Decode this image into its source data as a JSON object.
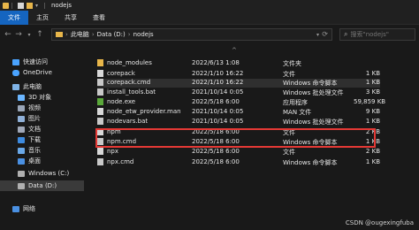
{
  "window": {
    "title": "nodejs"
  },
  "ribbon": {
    "tabs": [
      "文件",
      "主页",
      "共享",
      "查看"
    ]
  },
  "address": {
    "crumbs": [
      "此电脑",
      "Data (D:)",
      "nodejs"
    ]
  },
  "search": {
    "placeholder": "搜索\"nodejs\""
  },
  "sidebar": {
    "items": [
      {
        "label": "快速访问",
        "icon": "star-icon",
        "color": "#4aa3ff"
      },
      {
        "label": "OneDrive",
        "icon": "cloud-icon",
        "color": "#4aa3ff"
      },
      {
        "label": "此电脑",
        "icon": "computer-icon",
        "color": "#7fb3e6"
      },
      {
        "label": "3D 对象",
        "icon": "cube-icon",
        "color": "#6bb6ff"
      },
      {
        "label": "视频",
        "icon": "video-icon",
        "color": "#9aa6b8"
      },
      {
        "label": "图片",
        "icon": "picture-icon",
        "color": "#8fb0d8"
      },
      {
        "label": "文档",
        "icon": "document-icon",
        "color": "#a0a8b8"
      },
      {
        "label": "下载",
        "icon": "download-icon",
        "color": "#3d8be0"
      },
      {
        "label": "音乐",
        "icon": "music-icon",
        "color": "#6aa8e8"
      },
      {
        "label": "桌面",
        "icon": "desktop-icon",
        "color": "#4a90e2"
      },
      {
        "label": "Windows (C:)",
        "icon": "drive-icon",
        "color": "#b0b0b0"
      },
      {
        "label": "Data (D:)",
        "icon": "drive-icon",
        "color": "#b0b0b0"
      },
      {
        "label": "网络",
        "icon": "network-icon",
        "color": "#4a90e2"
      }
    ]
  },
  "files": [
    {
      "name": "node_modules",
      "date": "2022/6/13 1:08",
      "type": "文件夹",
      "size": "",
      "icon": "folder-icon",
      "color": "#e8b64a"
    },
    {
      "name": "corepack",
      "date": "2022/1/10 16:22",
      "type": "文件",
      "size": "1 KB",
      "icon": "file-icon",
      "color": "#d8d8d8"
    },
    {
      "name": "corepack.cmd",
      "date": "2022/1/10 16:22",
      "type": "Windows 命令脚本",
      "size": "1 KB",
      "icon": "script-icon",
      "color": "#c8c8c8"
    },
    {
      "name": "install_tools.bat",
      "date": "2021/10/14 0:05",
      "type": "Windows 批处理文件",
      "size": "3 KB",
      "icon": "script-icon",
      "color": "#c8c8c8"
    },
    {
      "name": "node.exe",
      "date": "2022/5/18 6:00",
      "type": "应用程序",
      "size": "59,859 KB",
      "icon": "node-icon",
      "color": "#5aa83a"
    },
    {
      "name": "node_etw_provider.man",
      "date": "2021/10/14 0:05",
      "type": "MAN 文件",
      "size": "9 KB",
      "icon": "file-icon",
      "color": "#d8d8d8"
    },
    {
      "name": "nodevars.bat",
      "date": "2021/10/14 0:05",
      "type": "Windows 批处理文件",
      "size": "1 KB",
      "icon": "script-icon",
      "color": "#c8c8c8"
    },
    {
      "name": "npm",
      "date": "2022/5/18 6:00",
      "type": "文件",
      "size": "2 KB",
      "icon": "file-icon",
      "color": "#d8d8d8"
    },
    {
      "name": "npm.cmd",
      "date": "2022/5/18 6:00",
      "type": "Windows 命令脚本",
      "size": "1 KB",
      "icon": "script-icon",
      "color": "#c8c8c8"
    },
    {
      "name": "npx",
      "date": "2022/5/18 6:00",
      "type": "文件",
      "size": "2 KB",
      "icon": "file-icon",
      "color": "#d8d8d8"
    },
    {
      "name": "npx.cmd",
      "date": "2022/5/18 6:00",
      "type": "Windows 命令脚本",
      "size": "1 KB",
      "icon": "script-icon",
      "color": "#c8c8c8"
    }
  ],
  "watermark": "CSDN @ougexingfuba"
}
